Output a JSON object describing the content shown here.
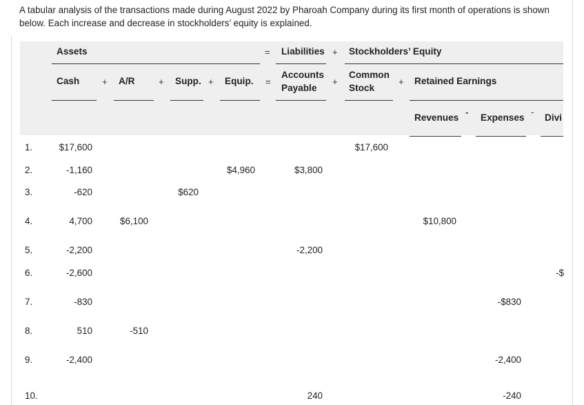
{
  "intro": "A tabular analysis of the transactions made during August 2022 by Pharoah Company during its first month of operations is shown below. Each increase and decrease in stockholders’ equity is explained.",
  "headers": {
    "assets": "Assets",
    "eq_sign_top": "=",
    "liabilities": "Liabilities",
    "plus_top": "+",
    "stockholders_equity": "Stockholders’ Equity",
    "cash": "Cash",
    "plus1": "+",
    "ar": "A/R",
    "plus2": "+",
    "supp": "Supp.",
    "plus3": "+",
    "equip": "Equip.",
    "eq_sign": "=",
    "accounts": "Accounts",
    "payable": "Payable",
    "plus4": "+",
    "common": "Common",
    "stock": "Stock",
    "plus5": "+",
    "retained_earnings": "Retained Earnings",
    "revenues": "Revenues",
    "minus1": "-",
    "expenses": "Expenses",
    "minus2": "-",
    "dividends_partial": "Divi"
  },
  "rows": [
    {
      "num": "1.",
      "cash": "$17,600",
      "ar": "",
      "supp": "",
      "equip": "",
      "ap": "",
      "cs": "$17,600",
      "rev": "",
      "exp": "",
      "div": ""
    },
    {
      "num": "2.",
      "cash": "-1,160",
      "ar": "",
      "supp": "",
      "equip": "$4,960",
      "ap": "$3,800",
      "cs": "",
      "rev": "",
      "exp": "",
      "div": ""
    },
    {
      "num": "3.",
      "cash": "-620",
      "ar": "",
      "supp": "$620",
      "equip": "",
      "ap": "",
      "cs": "",
      "rev": "",
      "exp": "",
      "div": ""
    },
    {
      "num": "4.",
      "cash": "4,700",
      "ar": "$6,100",
      "supp": "",
      "equip": "",
      "ap": "",
      "cs": "",
      "rev": "$10,800",
      "exp": "",
      "div": ""
    },
    {
      "num": "5.",
      "cash": "-2,200",
      "ar": "",
      "supp": "",
      "equip": "",
      "ap": "-2,200",
      "cs": "",
      "rev": "",
      "exp": "",
      "div": ""
    },
    {
      "num": "6.",
      "cash": "-2,600",
      "ar": "",
      "supp": "",
      "equip": "",
      "ap": "",
      "cs": "",
      "rev": "",
      "exp": "",
      "div": "-$"
    },
    {
      "num": "7.",
      "cash": "-830",
      "ar": "",
      "supp": "",
      "equip": "",
      "ap": "",
      "cs": "",
      "rev": "",
      "exp": "-$830",
      "div": ""
    },
    {
      "num": "8.",
      "cash": "510",
      "ar": "-510",
      "supp": "",
      "equip": "",
      "ap": "",
      "cs": "",
      "rev": "",
      "exp": "",
      "div": ""
    },
    {
      "num": "9.",
      "cash": "-2,400",
      "ar": "",
      "supp": "",
      "equip": "",
      "ap": "",
      "cs": "",
      "rev": "",
      "exp": "-2,400",
      "div": ""
    },
    {
      "num": "10.",
      "cash": "",
      "ar": "",
      "supp": "",
      "equip": "",
      "ap": "240",
      "cs": "",
      "rev": "",
      "exp": "-240",
      "div": ""
    }
  ]
}
